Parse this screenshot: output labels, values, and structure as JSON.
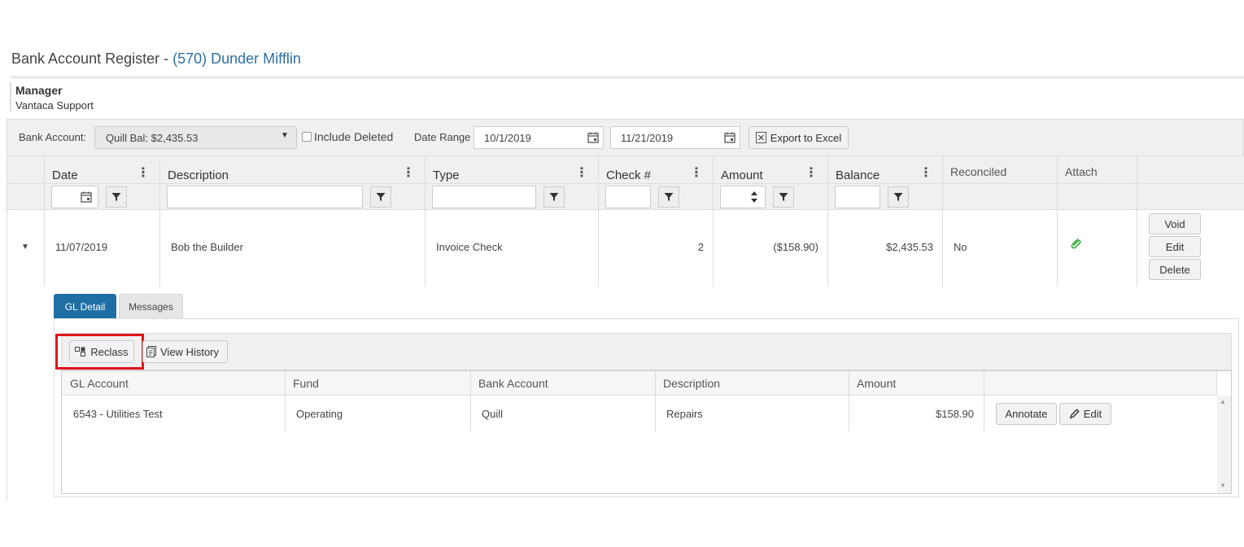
{
  "page": {
    "title_prefix": "Bank Account Register - ",
    "title_link": "(570) Dunder Mifflin",
    "manager_label": "Manager",
    "manager_name": "Vantaca Support"
  },
  "toolbar": {
    "bank_account_label": "Bank Account:",
    "bank_account_value": "Quill Bal: $2,435.53",
    "include_deleted_label": "Include Deleted",
    "include_deleted_checked": false,
    "date_range_label": "Date Range",
    "date_from": "10/1/2019",
    "date_to": "11/21/2019",
    "export_label": "Export to Excel"
  },
  "grid": {
    "columns": [
      "Date",
      "Description",
      "Type",
      "Check #",
      "Amount",
      "Balance",
      "Reconciled",
      "Attach"
    ],
    "row": {
      "date": "11/07/2019",
      "description": "Bob the Builder",
      "type": "Invoice Check",
      "check_no": "2",
      "amount": "($158.90)",
      "balance": "$2,435.53",
      "reconciled": "No"
    },
    "actions": [
      "Void",
      "Edit",
      "Delete"
    ]
  },
  "detail": {
    "tabs": [
      "GL Detail",
      "Messages"
    ],
    "active_tab": "GL Detail",
    "reclass_label": "Reclass",
    "view_history_label": "View History",
    "columns": [
      "GL Account",
      "Fund",
      "Bank Account",
      "Description",
      "Amount"
    ],
    "row": {
      "gl_account": "6543 - Utilities Test",
      "fund": "Operating",
      "bank_account": "Quill",
      "description": "Repairs",
      "amount": "$158.90"
    },
    "annotate_label": "Annotate",
    "edit_label": "Edit"
  },
  "colors": {
    "link": "#2e6fa3",
    "tab_active": "#1f6fa5",
    "highlight": "#e0141c",
    "attach_icon": "#3cb043"
  },
  "icons": [
    "calendar-icon",
    "filter-icon",
    "kebab-icon",
    "excel-icon",
    "caret-down-icon",
    "paperclip-icon",
    "reclass-icon",
    "history-icon",
    "pencil-icon",
    "spinner-icon",
    "scroll-up-icon",
    "scroll-down-icon"
  ]
}
